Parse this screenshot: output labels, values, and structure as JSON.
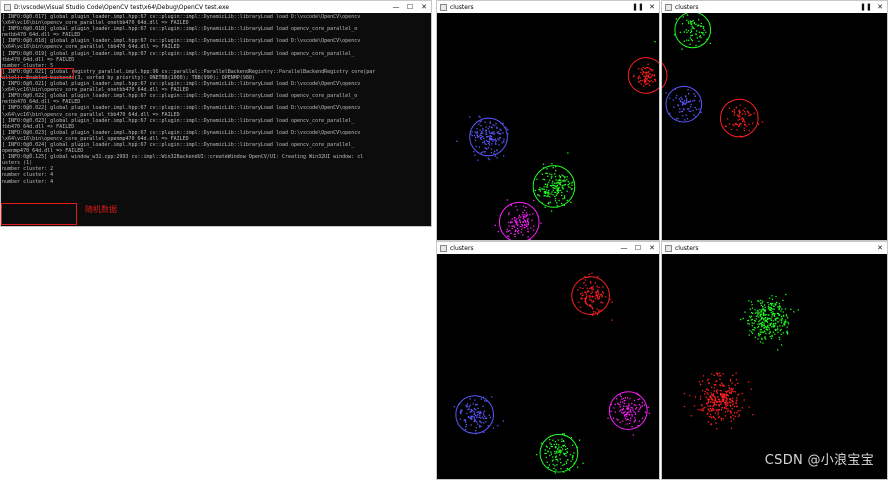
{
  "colors": {
    "red": "#ff2020",
    "green": "#22ff22",
    "blue": "#5a5aff",
    "magenta": "#ff20ff",
    "annotation": "#e01919",
    "console_text": "#bdbdbd"
  },
  "console": {
    "title": "D:\\vscode\\Visual Studio Code\\OpenCV test\\x64\\Debug\\OpenCV test.exe",
    "lines": [
      "[ INFO:0@0.017] global plugin_loader.impl.hpp:67 cv::plugin::impl::DynamicLib::libraryLoad load D:\\vscode\\OpenCV\\opencv",
      "\\x64\\vc16\\bin\\opencv_core_parallel_onetbb470_64d.dll => FAILED",
      "[ INFO:0@0.018] global plugin_loader.impl.hpp:67 cv::plugin::impl::DynamicLib::libraryLoad load opencv_core_parallel_o",
      "netbb470_64d.dll => FAILED",
      "[ INFO:0@0.018] global plugin_loader.impl.hpp:67 cv::plugin::impl::DynamicLib::libraryLoad load D:\\vscode\\OpenCV\\opencv",
      "\\x64\\vc16\\bin\\opencv_core_parallel_tbb470_64d.dll => FAILED",
      "[ INFO:0@0.019] global plugin_loader.impl.hpp:67 cv::plugin::impl::DynamicLib::libraryLoad load opencv_core_parallel_",
      "tbb470_64d.dll => FAILED",
      "number cluster: 5",
      "[ INFO:0@0.021] global registry_parallel.impl.hpp:96 cv::parallel::ParallelBackendRegistry::ParallelBackendRegistry core(par",
      "allel): Enabled backends(3, sorted by priority): ONETBB(1000); TBB(990); OPENMP(980)",
      "[ INFO:0@0.021] global plugin_loader.impl.hpp:67 cv::plugin::impl::DynamicLib::libraryLoad load D:\\vscode\\OpenCV\\opencv",
      "\\x64\\vc16\\bin\\opencv_core_parallel_onetbb470_64d.dll => FAILED",
      "[ INFO:0@0.022] global plugin_loader.impl.hpp:67 cv::plugin::impl::DynamicLib::libraryLoad load opencv_core_parallel_o",
      "netbb470_64d.dll => FAILED",
      "[ INFO:0@0.022] global plugin_loader.impl.hpp:67 cv::plugin::impl::DynamicLib::libraryLoad load D:\\vscode\\OpenCV\\opencv",
      "\\x64\\vc16\\bin\\opencv_core_parallel_tbb470_64d.dll => FAILED",
      "[ INFO:0@0.023] global plugin_loader.impl.hpp:67 cv::plugin::impl::DynamicLib::libraryLoad load opencv_core_parallel_",
      "tbb470_64d.dll => FAILED",
      "[ INFO:0@0.023] global plugin_loader.impl.hpp:67 cv::plugin::impl::DynamicLib::libraryLoad load D:\\vscode\\OpenCV\\opencv",
      "\\x64\\vc16\\bin\\opencv_core_parallel_openmp470_64d.dll => FAILED",
      "[ INFO:0@0.024] global plugin_loader.impl.hpp:67 cv::plugin::impl::DynamicLib::libraryLoad load opencv_core_parallel_",
      "openmp470_64d.dll => FAILED",
      "[ INFO:0@0.125] global window_w32.cpp:2993 cv::impl::Win32BackendUI::createWindow OpenCV/UI: Creating Win32UI window: cl",
      "usters (1)",
      "number cluster: 2",
      "number cluster: 4",
      "number cluster: 4"
    ],
    "annotation": "随机数据"
  },
  "windows": [
    {
      "title": "clusters"
    },
    {
      "title": "clusters"
    },
    {
      "title": "clusters"
    },
    {
      "title": "clusters"
    }
  ],
  "controls": {
    "minimize": "—",
    "maximize": "☐",
    "close": "✕",
    "pause": "❚❚"
  },
  "watermark": "CSDN @小浪宝宝"
}
